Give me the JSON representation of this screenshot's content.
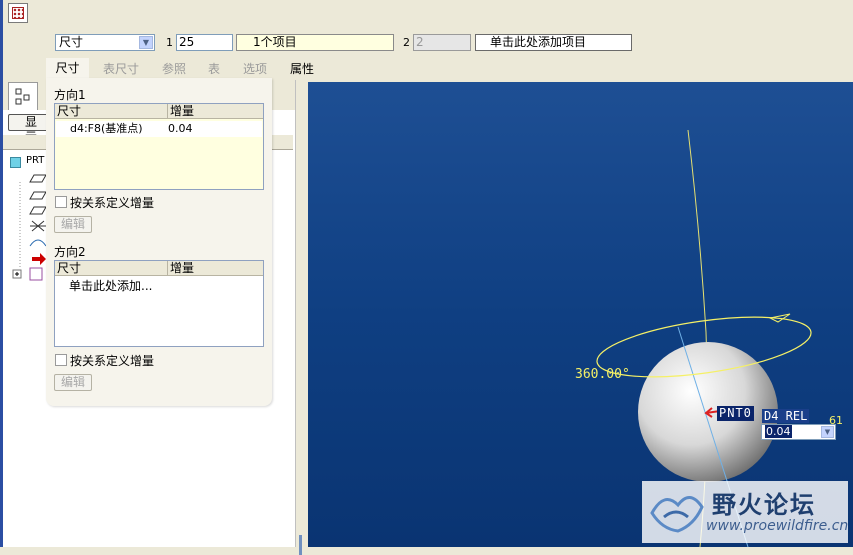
{
  "toolbar": {
    "dim_type_selected": "尺寸",
    "set1_index": "1",
    "set1_value": "25",
    "set1_items": "1个项目",
    "set2_index": "2",
    "set2_value": "2",
    "add_item_label": "单击此处添加项目"
  },
  "tabs": [
    {
      "label": "尺寸",
      "active": true
    },
    {
      "label": "表尺寸"
    },
    {
      "label": "参照"
    },
    {
      "label": "表"
    },
    {
      "label": "选项"
    },
    {
      "label": "属性"
    }
  ],
  "panel": {
    "direction1_label": "方向1",
    "direction2_label": "方向2",
    "col_dim": "尺寸",
    "col_incr": "增量",
    "dir1_row": {
      "dim": "d4:F8(基准点)",
      "incr": "0.04"
    },
    "dir2_placeholder": "单击此处添加...",
    "relation_checkbox_label": "按关系定义增量",
    "edit_button_label": "编辑"
  },
  "tree": {
    "show_button_label": "显示",
    "root_label": "PRT"
  },
  "viewport": {
    "angle_label": "360.00°",
    "tag_label": "PNT0",
    "dim_label": "D4 REL",
    "side_label": "61",
    "dim_value": "0.04",
    "colors": {
      "background": "#0f3f82",
      "curve": "#f5f066",
      "highlight": "#d22222"
    }
  },
  "watermark": {
    "title": "野火论坛",
    "url": "www.proewildfire.cn"
  }
}
